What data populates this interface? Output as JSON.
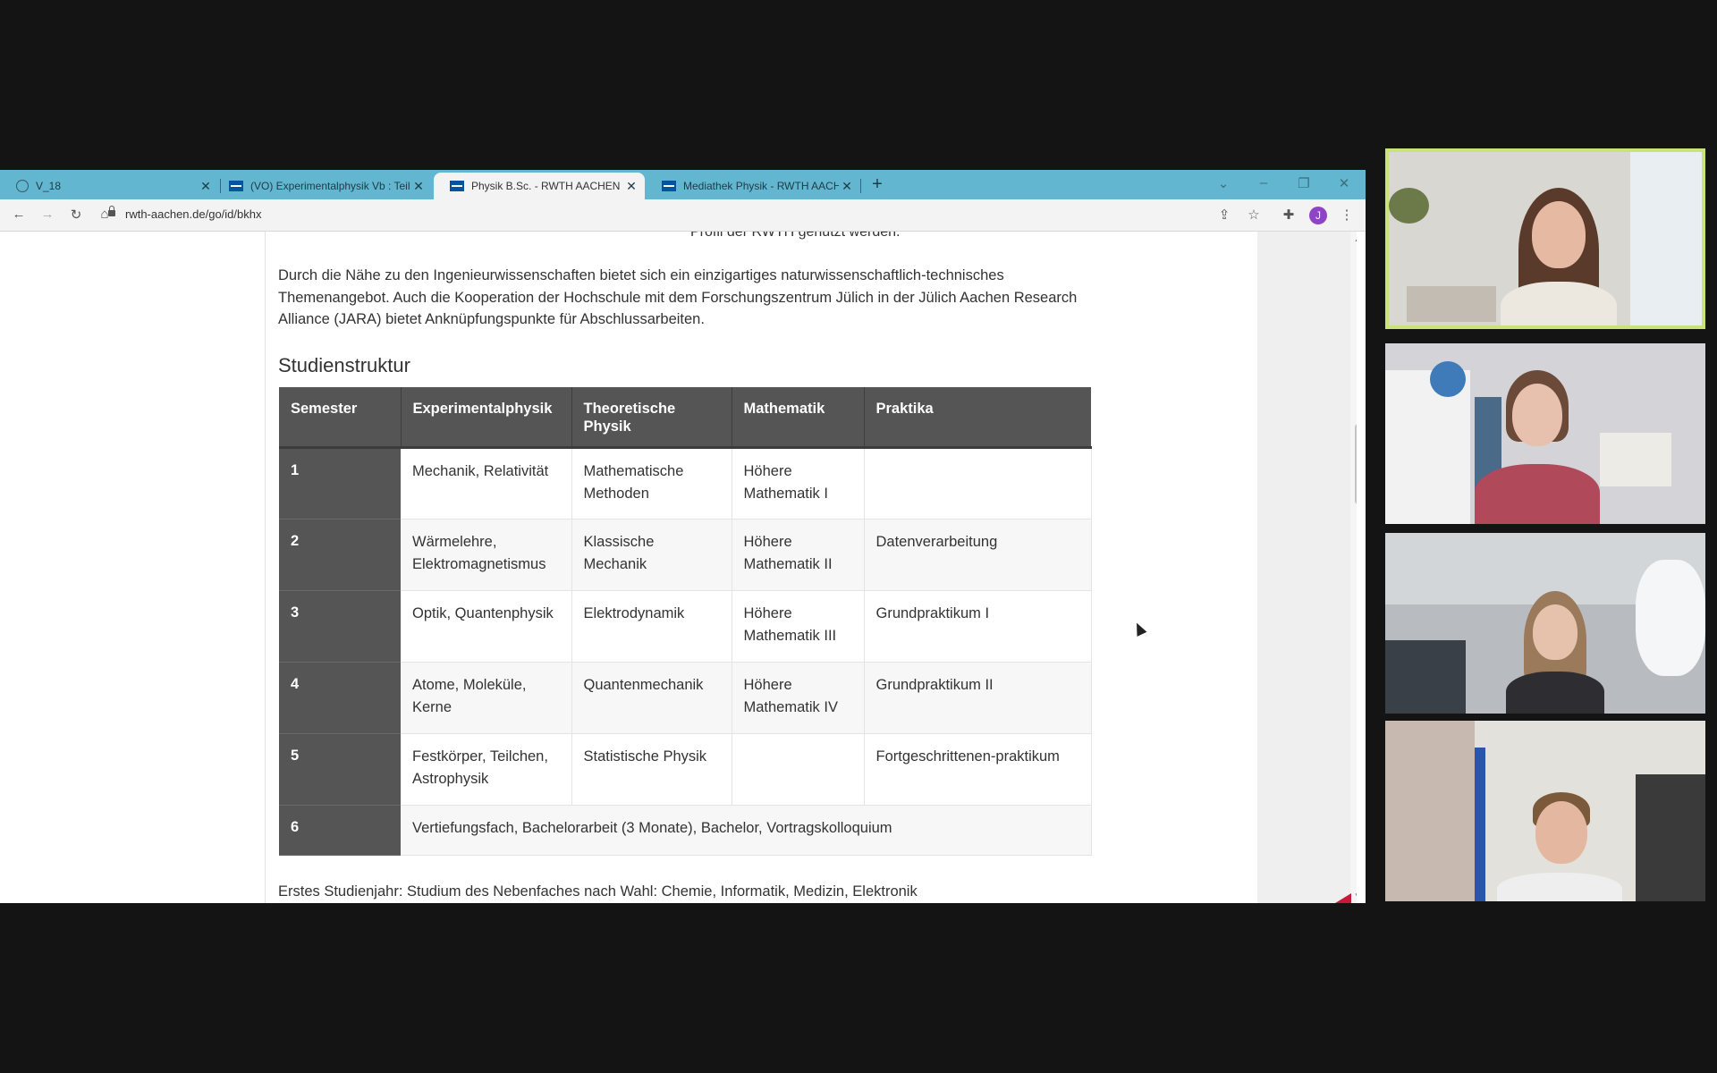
{
  "browser": {
    "tabs": [
      {
        "title": "V_18",
        "icon": "globe-icon",
        "active": false
      },
      {
        "title": "(VO) Experimentalphysik Vb : Teil",
        "icon": "rwth-favicon",
        "active": false
      },
      {
        "title": "Physik B.Sc. - RWTH AACHEN UN",
        "icon": "rwth-favicon",
        "active": true
      },
      {
        "title": "Mediathek Physik - RWTH AACH",
        "icon": "rwth-favicon",
        "active": false
      }
    ],
    "url": "rwth-aachen.de/go/id/bkhx",
    "profile_initial": "J"
  },
  "page": {
    "cut_text": "Profil der RWTH genutzt werden.",
    "intro": "Durch die Nähe zu den Ingenieurwissenschaften bietet sich ein einzigartiges naturwissenschaftlich-technisches Themenangebot. Auch die Kooperation der Hochschule mit dem Forschungszentrum Jülich in der Jülich Aachen Research Alliance (JARA) bietet Anknüpfungspunkte für Abschlussarbeiten.",
    "heading": "Studienstruktur",
    "table": {
      "headers": [
        "Semester",
        "Experimentalphysik",
        "Theoretische Physik",
        "Mathematik",
        "Praktika"
      ],
      "rows": [
        [
          "1",
          "Mechanik, Relativität",
          "Mathematische Methoden",
          "Höhere Mathematik I",
          ""
        ],
        [
          "2",
          "Wärmelehre, Elektromagnetismus",
          "Klassische Mechanik",
          "Höhere Mathematik II",
          "Datenverarbeitung"
        ],
        [
          "3",
          "Optik, Quantenphysik",
          "Elektrodynamik",
          "Höhere Mathematik III",
          "Grundpraktikum I"
        ],
        [
          "4",
          "Atome, Moleküle, Kerne",
          "Quantenmechanik",
          "Höhere Mathematik IV",
          "Grundpraktikum II"
        ],
        [
          "5",
          "Festkörper, Teilchen, Astrophysik",
          "Statistische Physik",
          "",
          "Fortgeschrittenen-praktikum"
        ]
      ],
      "last_row": {
        "semester": "6",
        "text": "Vertiefungsfach, Bachelorarbeit (3 Monate), Bachelor, Vortragskolloquium"
      }
    },
    "footer_line": "Erstes Studienjahr: Studium des Nebenfaches nach Wahl: Chemie, Informatik, Medizin, Elektronik"
  },
  "colors": {
    "tabbar": "#62b6cf",
    "table_header": "#555555",
    "speaker_border": "#c9e27a",
    "rwth_blue": "#00549f"
  },
  "participants": [
    {
      "tile": "participant-1",
      "speaking": true
    },
    {
      "tile": "participant-2",
      "speaking": false
    },
    {
      "tile": "participant-3",
      "speaking": false
    },
    {
      "tile": "participant-4",
      "speaking": false
    }
  ]
}
